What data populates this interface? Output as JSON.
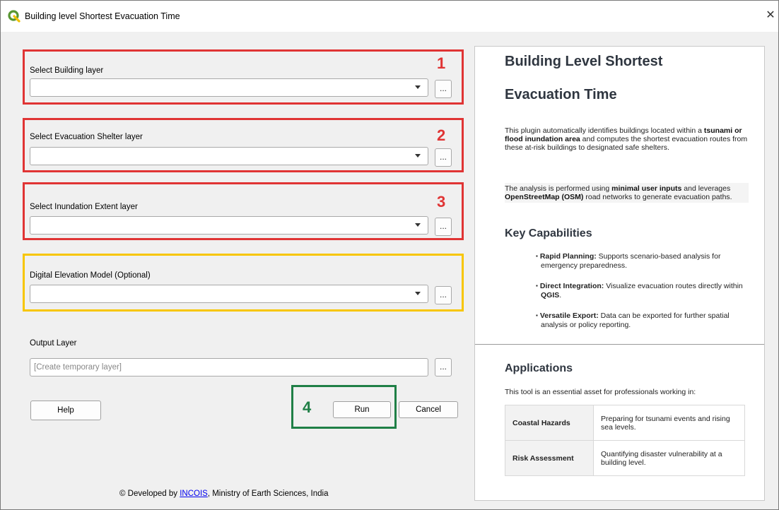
{
  "window": {
    "title": "Building level Shortest Evacuation Time",
    "close_glyph": "✕"
  },
  "form": {
    "building": {
      "label": "Select Building layer",
      "value": ""
    },
    "shelter": {
      "label": "Select Evacuation Shelter layer",
      "value": ""
    },
    "inundation": {
      "label": "Select Inundation Extent layer",
      "value": ""
    },
    "dem": {
      "label": "Digital Elevation Model (Optional)",
      "value": ""
    },
    "output": {
      "label": "Output Layer",
      "placeholder": "[Create temporary layer]"
    },
    "browse_label": "...",
    "help_label": "Help",
    "run_label": "Run",
    "cancel_label": "Cancel"
  },
  "annotations": {
    "n1": "1",
    "n2": "2",
    "n3": "3",
    "n4": "4"
  },
  "footer": {
    "prefix": "© Developed by ",
    "link": "INCOIS",
    "suffix": ", Ministry of Earth Sciences, India"
  },
  "panel": {
    "title_line1": "Building Level Shortest",
    "title_line2": "Evacuation Time",
    "intro": {
      "t1": "This plugin automatically identifies buildings located within a ",
      "b1": "tsunami or flood inundation area",
      "t2": " and computes the shortest evacuation routes from these at-risk buildings to designated safe shelters."
    },
    "analysis": {
      "t1": "The analysis is performed using ",
      "b1": "minimal user inputs",
      "t2": " and leverages ",
      "b2": "OpenStreetMap (OSM)",
      "t3": " road networks to generate evacuation paths."
    },
    "capabilities_heading": "Key Capabilities",
    "capabilities": [
      {
        "bold": "Rapid Planning:",
        "text": " Supports scenario-based analysis for emergency preparedness."
      },
      {
        "bold": "Direct Integration:",
        "text": " Visualize evacuation routes directly within ",
        "bold2": "QGIS",
        "text2": "."
      },
      {
        "bold": "Versatile Export:",
        "text": " Data can be exported for further spatial analysis or policy reporting."
      }
    ],
    "applications_heading": "Applications",
    "applications_intro": "This tool is an essential asset for professionals working in:",
    "table": [
      {
        "key": "Coastal Hazards",
        "value": "Preparing for tsunami events and rising sea levels."
      },
      {
        "key": "Risk Assessment",
        "value": "Quantifying disaster vulnerability at a building level."
      }
    ]
  },
  "colors": {
    "red": "#e03434",
    "yellow": "#f7c600",
    "green": "#1f7f46",
    "qgis_green": "#589632"
  }
}
